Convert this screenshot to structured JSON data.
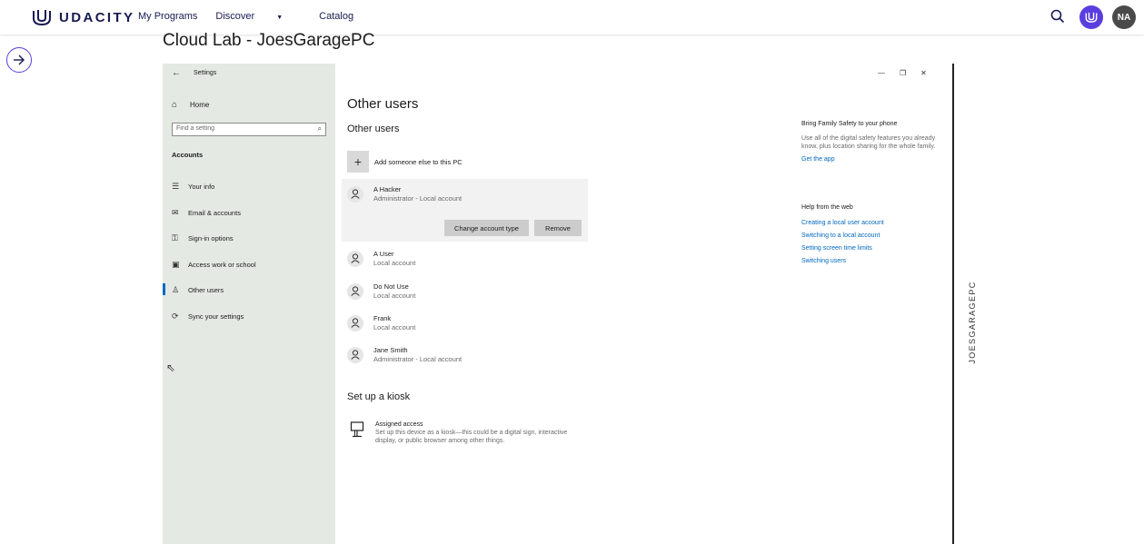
{
  "header": {
    "brand": "UDACITY",
    "nav": [
      "My Programs",
      "Discover",
      "Catalog"
    ],
    "avatar_initials": "NA",
    "brand_color": "#5a3ee0"
  },
  "lab": {
    "title": "Cloud Lab - JoesGaragePC",
    "machine_name": "JOESGARAGEPC"
  },
  "settings": {
    "window_title": "Settings",
    "home": "Home",
    "search_placeholder": "Find a setting",
    "category": "Accounts",
    "items": [
      {
        "icon": "person-card-icon",
        "label": "Your info"
      },
      {
        "icon": "mail-icon",
        "label": "Email & accounts"
      },
      {
        "icon": "key-icon",
        "label": "Sign-in options"
      },
      {
        "icon": "briefcase-icon",
        "label": "Access work or school"
      },
      {
        "icon": "people-icon",
        "label": "Other users"
      },
      {
        "icon": "sync-icon",
        "label": "Sync your settings"
      }
    ],
    "active_item": "Other users"
  },
  "page": {
    "heading": "Other users",
    "subheading": "Other users",
    "add_label": "Add someone else to this PC",
    "users": [
      {
        "name": "A Hacker",
        "role": "Administrator - Local account"
      },
      {
        "name": "A User",
        "role": "Local account"
      },
      {
        "name": "Do Not Use",
        "role": "Local account"
      },
      {
        "name": "Frank",
        "role": "Local account"
      },
      {
        "name": "Jane Smith",
        "role": "Administrator - Local account"
      }
    ],
    "change_button": "Change account type",
    "remove_button": "Remove",
    "kiosk_heading": "Set up a kiosk",
    "kiosk_title": "Assigned access",
    "kiosk_desc": "Set up this device as a kiosk—this could be a digital sign, interactive display, or public browser among other things."
  },
  "side": {
    "family_heading": "Bring Family Safety to your phone",
    "family_text": "Use all of the digital safety features you already know, plus location sharing for the whole family.",
    "family_link": "Get the app",
    "help_heading": "Help from the web",
    "help_links": [
      "Creating a local user account",
      "Switching to a local account",
      "Setting screen time limits",
      "Switching users"
    ]
  }
}
